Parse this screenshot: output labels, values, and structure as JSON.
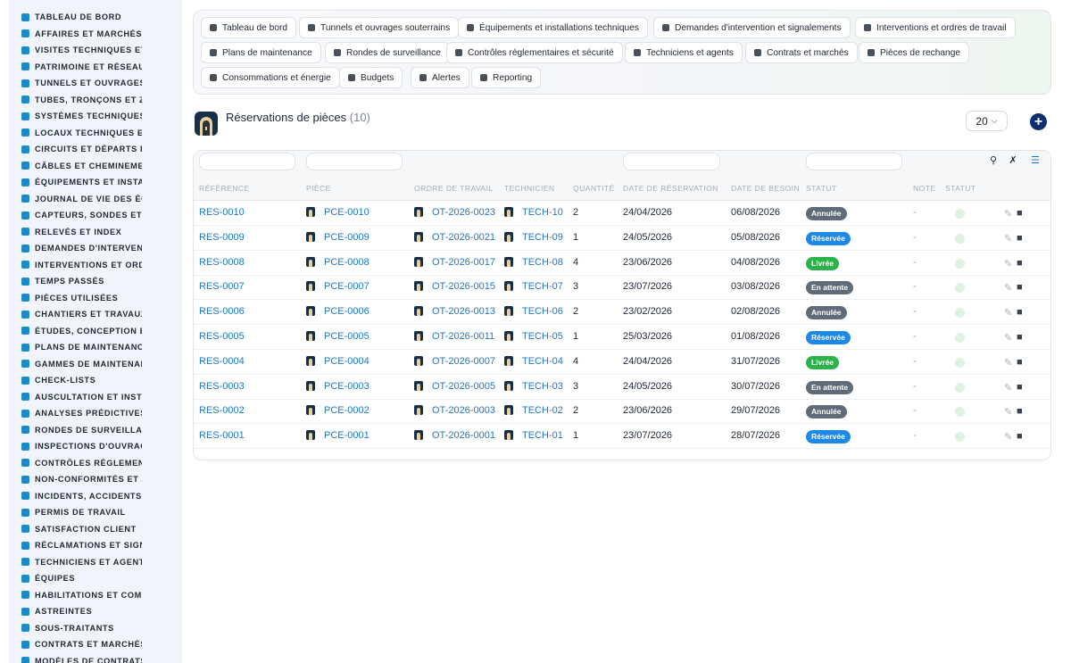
{
  "sidebar": {
    "items": [
      {
        "label": "TABLEAU DE BORD",
        "icon": "dashboard-icon"
      },
      {
        "label": "AFFAIRES ET MARCHÉS",
        "icon": "target-icon"
      },
      {
        "label": "VISITES TECHNIQUES ET",
        "icon": "book-icon"
      },
      {
        "label": "PATRIMOINE ET RÉSEAUX",
        "icon": "map-pin-icon"
      },
      {
        "label": "TUNNELS ET OUVRAGES",
        "icon": "tunnel-icon"
      },
      {
        "label": "TUBES, TRONÇONS ET ZO",
        "icon": "route-icon"
      },
      {
        "label": "SYSTÈMES TECHNIQUES",
        "icon": "sitemap-icon"
      },
      {
        "label": "LOCAUX TECHNIQUES ET",
        "icon": "grid-icon"
      },
      {
        "label": "CIRCUITS ET DÉPARTS É",
        "icon": "circuit-icon"
      },
      {
        "label": "CÂBLES ET CHEMINEMEN",
        "icon": "cable-icon"
      },
      {
        "label": "ÉQUIPEMENTS ET INSTAL",
        "icon": "cogs-icon"
      },
      {
        "label": "JOURNAL DE VIE DES ÉQ",
        "icon": "history-icon"
      },
      {
        "label": "CAPTEURS, SONDES ET C",
        "icon": "gauge-icon"
      },
      {
        "label": "RELEVÉS ET INDEX",
        "icon": "clipboard-icon"
      },
      {
        "label": "DEMANDES D'INTERVENT",
        "icon": "question-icon"
      },
      {
        "label": "INTERVENTIONS ET ORDI",
        "icon": "file-icon"
      },
      {
        "label": "TEMPS PASSÉS",
        "icon": "clock-icon"
      },
      {
        "label": "PIÈCES UTILISÉES",
        "icon": "box-icon"
      },
      {
        "label": "CHANTIERS ET TRAVAUX",
        "icon": "hammer-icon"
      },
      {
        "label": "ÉTUDES, CONCEPTION ET",
        "icon": "compass-icon"
      },
      {
        "label": "PLANS DE MAINTENANCE",
        "icon": "calendar-icon"
      },
      {
        "label": "GAMMES DE MAINTENAN",
        "icon": "list-icon"
      },
      {
        "label": "CHECK-LISTS",
        "icon": "checklist-icon"
      },
      {
        "label": "AUSCULTATION ET INSTR",
        "icon": "stethoscope-icon"
      },
      {
        "label": "ANALYSES PRÉDICTIVES",
        "icon": "chart-icon"
      },
      {
        "label": "RONDES DE SURVEILLAN",
        "icon": "route-icon"
      },
      {
        "label": "INSPECTIONS D'OUVRAG",
        "icon": "search-icon"
      },
      {
        "label": "CONTRÔLES RÉGLEMEN",
        "icon": "clipboard-check-icon"
      },
      {
        "label": "NON-CONFORMITÉS ET A",
        "icon": "alert-circle-icon"
      },
      {
        "label": "INCIDENTS, ACCIDENTS E",
        "icon": "warning-icon"
      },
      {
        "label": "PERMIS DE TRAVAIL",
        "icon": "file-signature-icon"
      },
      {
        "label": "SATISFACTION CLIENT",
        "icon": "smile-icon"
      },
      {
        "label": "RÉCLAMATIONS ET SIGN",
        "icon": "comment-icon"
      },
      {
        "label": "TECHNICIENS ET AGENTS",
        "icon": "hardhat-icon"
      },
      {
        "label": "ÉQUIPES",
        "icon": "users-icon"
      },
      {
        "label": "HABILITATIONS ET COMP",
        "icon": "certificate-icon"
      },
      {
        "label": "ASTREINTES",
        "icon": "phone-icon"
      },
      {
        "label": "SOUS-TRAITANTS",
        "icon": "handshake-icon"
      },
      {
        "label": "CONTRATS ET MARCHÉS",
        "icon": "contract-icon"
      },
      {
        "label": "MODÈLES DE CONTRATS",
        "icon": "file-icon"
      }
    ]
  },
  "topnav": {
    "buttons": [
      {
        "label": "Tableau de bord",
        "icon": "dashboard-icon"
      },
      {
        "label": "Tunnels et ouvrages souterrains",
        "icon": "building-icon"
      },
      {
        "label": "Équipements et installations techniques",
        "icon": "cogs-icon"
      },
      {
        "label": "Demandes d'intervention et signalements",
        "icon": "question-icon"
      },
      {
        "label": "Interventions et ordres de travail",
        "icon": "file-icon"
      },
      {
        "label": "Plans de maintenance",
        "icon": "calendar-icon"
      },
      {
        "label": "Rondes de surveillance",
        "icon": "route-icon"
      },
      {
        "label": "Contrôles réglementaires et sécurité",
        "icon": "clipboard-check-icon"
      },
      {
        "label": "Techniciens et agents",
        "icon": "hardhat-icon"
      },
      {
        "label": "Contrats et marchés",
        "icon": "contract-icon"
      },
      {
        "label": "Pièces de rechange",
        "icon": "sitemap-icon"
      },
      {
        "label": "Consommations et énergie",
        "icon": "bolt-icon"
      },
      {
        "label": "Budgets",
        "icon": "money-icon"
      },
      {
        "label": "Alertes",
        "icon": "bell-icon"
      },
      {
        "label": "Reporting",
        "icon": "pie-icon"
      }
    ]
  },
  "page": {
    "title": "Réservations de pièces",
    "count": "(10)",
    "page_size": "20",
    "add_label": "+"
  },
  "table": {
    "headers": {
      "reference": "Référence",
      "piece": "Pièce",
      "ordre": "Ordre de travail",
      "technicien": "Technicien",
      "quantite": "Quantité",
      "date_reservation": "Date de réservation",
      "date_besoin": "Date de besoin",
      "statut": "Statut",
      "note": "Note",
      "statut2": "Statut"
    },
    "rows": [
      {
        "ref": "RES-0010",
        "piece": "PCE-0010",
        "ordre": "OT-2026-0023",
        "tech": "TECH-10",
        "qte": "2",
        "dres": "24/04/2026",
        "dbes": "06/08/2026",
        "statut": "Annulée",
        "note": "-"
      },
      {
        "ref": "RES-0009",
        "piece": "PCE-0009",
        "ordre": "OT-2026-0021",
        "tech": "TECH-09",
        "qte": "1",
        "dres": "24/05/2026",
        "dbes": "05/08/2026",
        "statut": "Réservée",
        "note": "-"
      },
      {
        "ref": "RES-0008",
        "piece": "PCE-0008",
        "ordre": "OT-2026-0017",
        "tech": "TECH-08",
        "qte": "4",
        "dres": "23/06/2026",
        "dbes": "04/08/2026",
        "statut": "Livrée",
        "note": "-"
      },
      {
        "ref": "RES-0007",
        "piece": "PCE-0007",
        "ordre": "OT-2026-0015",
        "tech": "TECH-07",
        "qte": "3",
        "dres": "23/07/2026",
        "dbes": "03/08/2026",
        "statut": "En attente",
        "note": "-"
      },
      {
        "ref": "RES-0006",
        "piece": "PCE-0006",
        "ordre": "OT-2026-0013",
        "tech": "TECH-06",
        "qte": "2",
        "dres": "23/02/2026",
        "dbes": "02/08/2026",
        "statut": "Annulée",
        "note": "-"
      },
      {
        "ref": "RES-0005",
        "piece": "PCE-0005",
        "ordre": "OT-2026-0011",
        "tech": "TECH-05",
        "qte": "1",
        "dres": "25/03/2026",
        "dbes": "01/08/2026",
        "statut": "Réservée",
        "note": "-"
      },
      {
        "ref": "RES-0004",
        "piece": "PCE-0004",
        "ordre": "OT-2026-0007",
        "tech": "TECH-04",
        "qte": "4",
        "dres": "24/04/2026",
        "dbes": "31/07/2026",
        "statut": "Livrée",
        "note": "-"
      },
      {
        "ref": "RES-0003",
        "piece": "PCE-0003",
        "ordre": "OT-2026-0005",
        "tech": "TECH-03",
        "qte": "3",
        "dres": "24/05/2026",
        "dbes": "30/07/2026",
        "statut": "En attente",
        "note": "-"
      },
      {
        "ref": "RES-0002",
        "piece": "PCE-0002",
        "ordre": "OT-2026-0003",
        "tech": "TECH-02",
        "qte": "2",
        "dres": "23/06/2026",
        "dbes": "29/07/2026",
        "statut": "Annulée",
        "note": "-"
      },
      {
        "ref": "RES-0001",
        "piece": "PCE-0001",
        "ordre": "OT-2026-0001",
        "tech": "TECH-01",
        "qte": "1",
        "dres": "23/07/2026",
        "dbes": "28/07/2026",
        "statut": "Réservée",
        "note": "-"
      }
    ]
  },
  "status_colors": {
    "Annulée": "#5f6b78",
    "Réservée": "#1e88e5",
    "Livrée": "#2bb34a",
    "En attente": "#5f6b78"
  },
  "colors": {
    "link": "#1e77c6",
    "sidebar_icon": "#1a8acb",
    "add_button": "#0b2f6e"
  }
}
